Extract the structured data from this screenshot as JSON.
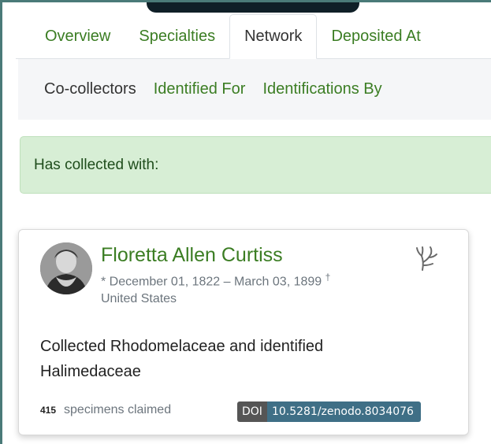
{
  "tabs": [
    {
      "label": "Overview",
      "active": false
    },
    {
      "label": "Specialties",
      "active": false
    },
    {
      "label": "Network",
      "active": true
    },
    {
      "label": "Deposited At",
      "active": false
    }
  ],
  "subnav": [
    {
      "label": "Co-collectors",
      "active": true
    },
    {
      "label": "Identified For",
      "active": false
    },
    {
      "label": "Identifications By",
      "active": false
    }
  ],
  "alert": {
    "text": "Has collected with:"
  },
  "card": {
    "name": "Floretta Allen Curtiss",
    "dates": "* December 01, 1822 – March 03, 1899",
    "death_mark": "†",
    "country": "United States",
    "description": "Collected Rhodomelaceae and identified Halimedaceae",
    "specimens_count": "415",
    "specimens_label": "specimens claimed",
    "doi_label": "DOI",
    "doi_value": "10.5281/zenodo.8034076",
    "icon": "algae-icon"
  },
  "colors": {
    "link_green": "#3b7d23",
    "alert_bg": "#d7eed5",
    "doi_value_bg": "#3f6f86",
    "doi_label_bg": "#555555",
    "frame_border": "#4a7a78"
  }
}
